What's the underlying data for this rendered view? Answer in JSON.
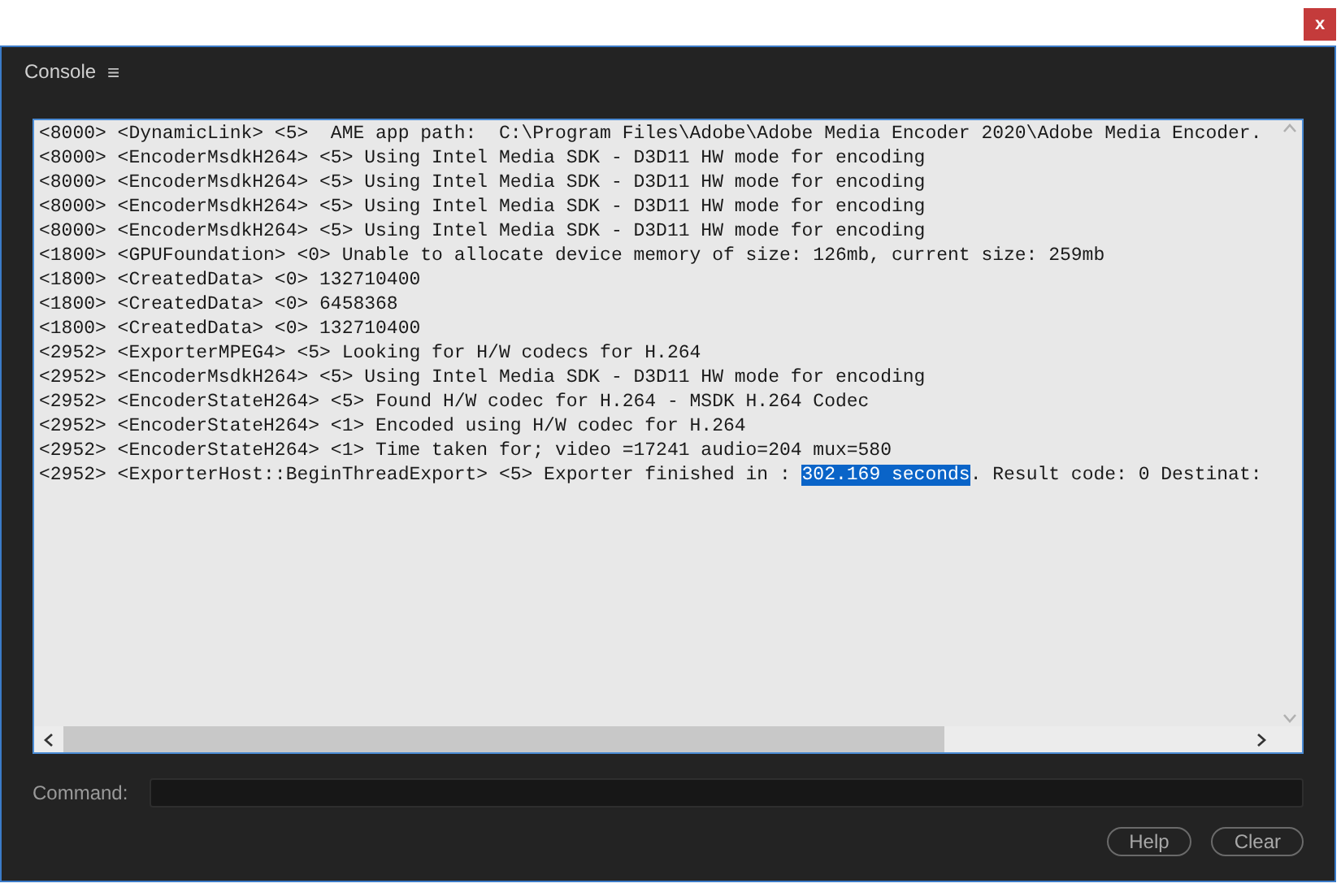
{
  "close_button": {
    "label": "x"
  },
  "panel": {
    "title": "Console",
    "menu_icon": "≡"
  },
  "log_lines": [
    {
      "segments": [
        {
          "text": "<8000> <DynamicLink> <5>  AME app path:  C:\\Program Files\\Adobe\\Adobe Media Encoder 2020\\Adobe Media Encoder.",
          "selected": false
        }
      ]
    },
    {
      "segments": [
        {
          "text": "<8000> <EncoderMsdkH264> <5> Using Intel Media SDK - D3D11 HW mode for encoding",
          "selected": false
        }
      ]
    },
    {
      "segments": [
        {
          "text": "<8000> <EncoderMsdkH264> <5> Using Intel Media SDK - D3D11 HW mode for encoding",
          "selected": false
        }
      ]
    },
    {
      "segments": [
        {
          "text": "<8000> <EncoderMsdkH264> <5> Using Intel Media SDK - D3D11 HW mode for encoding",
          "selected": false
        }
      ]
    },
    {
      "segments": [
        {
          "text": "<8000> <EncoderMsdkH264> <5> Using Intel Media SDK - D3D11 HW mode for encoding",
          "selected": false
        }
      ]
    },
    {
      "segments": [
        {
          "text": "<1800> <GPUFoundation> <0> Unable to allocate device memory of size: 126mb, current size: 259mb",
          "selected": false
        }
      ]
    },
    {
      "segments": [
        {
          "text": "<1800> <CreatedData> <0> 132710400",
          "selected": false
        }
      ]
    },
    {
      "segments": [
        {
          "text": "<1800> <CreatedData> <0> 6458368",
          "selected": false
        }
      ]
    },
    {
      "segments": [
        {
          "text": "<1800> <CreatedData> <0> 132710400",
          "selected": false
        }
      ]
    },
    {
      "segments": [
        {
          "text": "<2952> <ExporterMPEG4> <5> Looking for H/W codecs for H.264",
          "selected": false
        }
      ]
    },
    {
      "segments": [
        {
          "text": "<2952> <EncoderMsdkH264> <5> Using Intel Media SDK - D3D11 HW mode for encoding",
          "selected": false
        }
      ]
    },
    {
      "segments": [
        {
          "text": "<2952> <EncoderStateH264> <5> Found H/W codec for H.264 - MSDK H.264 Codec",
          "selected": false
        }
      ]
    },
    {
      "segments": [
        {
          "text": "<2952> <EncoderStateH264> <1> Encoded using H/W codec for H.264",
          "selected": false
        }
      ]
    },
    {
      "segments": [
        {
          "text": "<2952> <EncoderStateH264> <1> Time taken for; video =17241 audio=204 mux=580",
          "selected": false
        }
      ]
    },
    {
      "segments": [
        {
          "text": "<2952> <ExporterHost::BeginThreadExport> <5> Exporter finished in : ",
          "selected": false
        },
        {
          "text": "302.169 seconds",
          "selected": true
        },
        {
          "text": ". Result code: 0 Destinat:",
          "selected": false
        }
      ]
    }
  ],
  "command": {
    "label": "Command:"
  },
  "buttons": [
    {
      "label": "Help"
    },
    {
      "label": "Clear"
    }
  ]
}
